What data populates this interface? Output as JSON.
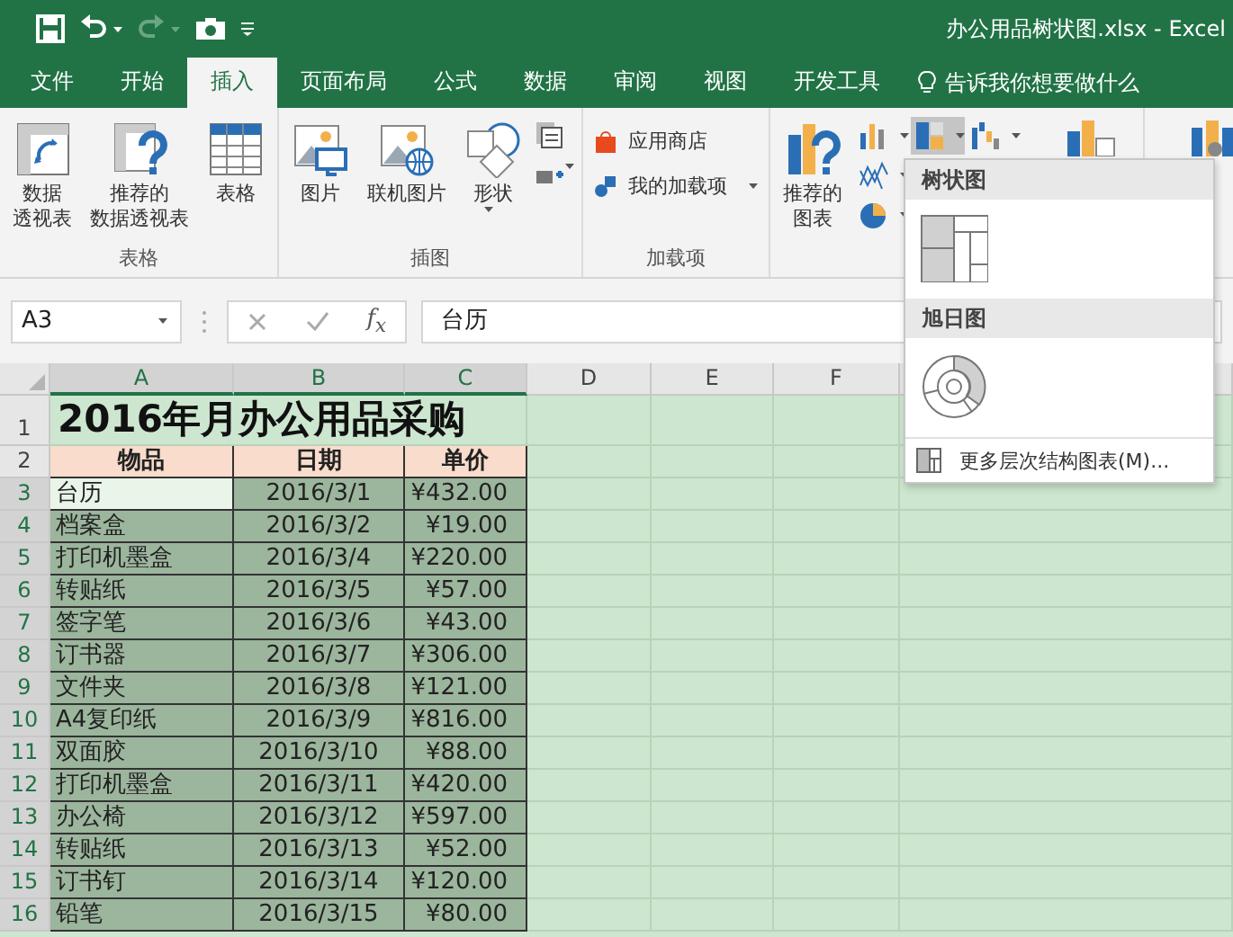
{
  "window": {
    "title": "办公用品树状图.xlsx  -  Excel"
  },
  "tabs": [
    {
      "label": "文件",
      "selected": false
    },
    {
      "label": "开始",
      "selected": false
    },
    {
      "label": "插入",
      "selected": true
    },
    {
      "label": "页面布局",
      "selected": false
    },
    {
      "label": "公式",
      "selected": false
    },
    {
      "label": "数据",
      "selected": false
    },
    {
      "label": "审阅",
      "selected": false
    },
    {
      "label": "视图",
      "selected": false
    },
    {
      "label": "开发工具",
      "selected": false
    }
  ],
  "tell_me": "告诉我你想要做什么",
  "ribbon": [
    {
      "label": "表格",
      "items": [
        {
          "kind": "pivot",
          "label_lines": [
            "数据",
            "透视表"
          ]
        },
        {
          "kind": "recommended-pivot",
          "label_lines": [
            "推荐的",
            "数据透视表"
          ]
        },
        {
          "kind": "table",
          "label_lines": [
            "表格"
          ]
        }
      ]
    },
    {
      "label": "插图",
      "items": [
        {
          "kind": "picture",
          "label_lines": [
            "图片"
          ]
        },
        {
          "kind": "online-picture",
          "label_lines": [
            "联机图片"
          ]
        },
        {
          "kind": "shapes",
          "label_lines": [
            "形状"
          ]
        },
        {
          "kind": "small-stack"
        }
      ]
    },
    {
      "label": "加载项",
      "items": [
        {
          "kind": "addin-list",
          "entries": [
            {
              "kind": "store",
              "label": "应用商店"
            },
            {
              "kind": "my-addins",
              "label": "我的加载项"
            }
          ]
        }
      ]
    },
    {
      "items": [
        {
          "kind": "recommended-chart",
          "label_lines": [
            "推荐的",
            "图表"
          ]
        },
        {
          "kind": "chart-grid",
          "charts": [
            {
              "kind": "column",
              "selected": false
            },
            {
              "kind": "hierarchy",
              "selected": true
            },
            {
              "kind": "waterfall",
              "selected": false
            },
            {
              "kind": "scatter",
              "selected": false
            },
            {
              "kind": "pie",
              "selected": false
            }
          ]
        },
        {
          "kind": "pivot-chart"
        }
      ]
    },
    {
      "items": [
        {
          "kind": "map3d"
        }
      ]
    }
  ],
  "name_box": "A3",
  "fx": "f$_{x}$",
  "formula": "台历",
  "sheet": {
    "columns": [
      {
        "label": "A",
        "selected": true
      },
      {
        "label": "B",
        "selected": true
      },
      {
        "label": "C",
        "selected": true
      },
      {
        "label": "D",
        "selected": false
      },
      {
        "label": "E",
        "selected": false
      },
      {
        "label": "F",
        "selected": false
      }
    ],
    "rows": [
      {
        "number": "1",
        "kind": "title",
        "selected": false,
        "cells": [
          "2016年月办公用品采购"
        ]
      },
      {
        "number": "2",
        "kind": "header",
        "selected": false,
        "cells": [
          "物品",
          "日期",
          "单价"
        ]
      },
      {
        "number": "3",
        "kind": "data",
        "selected": true,
        "active": true,
        "cells": [
          "台历",
          "2016/3/1",
          "¥432.00"
        ]
      },
      {
        "number": "4",
        "kind": "data",
        "selected": true,
        "active": false,
        "cells": [
          "档案盒",
          "2016/3/2",
          "¥19.00"
        ]
      },
      {
        "number": "5",
        "kind": "data",
        "selected": true,
        "active": false,
        "cells": [
          "打印机墨盒",
          "2016/3/4",
          "¥220.00"
        ]
      },
      {
        "number": "6",
        "kind": "data",
        "selected": true,
        "active": false,
        "cells": [
          "转贴纸",
          "2016/3/5",
          "¥57.00"
        ]
      },
      {
        "number": "7",
        "kind": "data",
        "selected": true,
        "active": false,
        "cells": [
          "签字笔",
          "2016/3/6",
          "¥43.00"
        ]
      },
      {
        "number": "8",
        "kind": "data",
        "selected": true,
        "active": false,
        "cells": [
          "订书器",
          "2016/3/7",
          "¥306.00"
        ]
      },
      {
        "number": "9",
        "kind": "data",
        "selected": true,
        "active": false,
        "cells": [
          "文件夹",
          "2016/3/8",
          "¥121.00"
        ]
      },
      {
        "number": "10",
        "kind": "data",
        "selected": true,
        "active": false,
        "cells": [
          "A4复印纸",
          "2016/3/9",
          "¥816.00"
        ]
      },
      {
        "number": "11",
        "kind": "data",
        "selected": true,
        "active": false,
        "cells": [
          "双面胶",
          "2016/3/10",
          "¥88.00"
        ]
      },
      {
        "number": "12",
        "kind": "data",
        "selected": true,
        "active": false,
        "cells": [
          "打印机墨盒",
          "2016/3/11",
          "¥420.00"
        ]
      },
      {
        "number": "13",
        "kind": "data",
        "selected": true,
        "active": false,
        "cells": [
          "办公椅",
          "2016/3/12",
          "¥597.00"
        ]
      },
      {
        "number": "14",
        "kind": "data",
        "selected": true,
        "active": false,
        "cells": [
          "转贴纸",
          "2016/3/13",
          "¥52.00"
        ]
      },
      {
        "number": "15",
        "kind": "data",
        "selected": true,
        "active": false,
        "cells": [
          "订书钉",
          "2016/3/14",
          "¥120.00"
        ]
      },
      {
        "number": "16",
        "kind": "data",
        "selected": true,
        "active": false,
        "cells": [
          "铅笔",
          "2016/3/15",
          "¥80.00"
        ]
      }
    ]
  },
  "dropdown": {
    "sections": [
      {
        "heading": "树状图",
        "kind": "treemap"
      },
      {
        "heading": "旭日图",
        "kind": "sunburst"
      }
    ],
    "more": "更多层次结构图表(M)..."
  }
}
